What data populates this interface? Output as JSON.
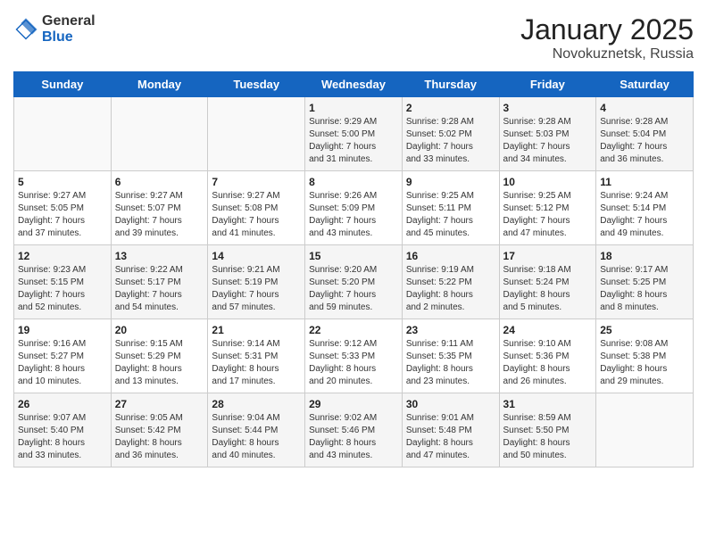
{
  "logo": {
    "general": "General",
    "blue": "Blue"
  },
  "title": {
    "month": "January 2025",
    "location": "Novokuznetsk, Russia"
  },
  "weekdays": [
    "Sunday",
    "Monday",
    "Tuesday",
    "Wednesday",
    "Thursday",
    "Friday",
    "Saturday"
  ],
  "weeks": [
    [
      {
        "day": "",
        "info": ""
      },
      {
        "day": "",
        "info": ""
      },
      {
        "day": "",
        "info": ""
      },
      {
        "day": "1",
        "info": "Sunrise: 9:29 AM\nSunset: 5:00 PM\nDaylight: 7 hours\nand 31 minutes."
      },
      {
        "day": "2",
        "info": "Sunrise: 9:28 AM\nSunset: 5:02 PM\nDaylight: 7 hours\nand 33 minutes."
      },
      {
        "day": "3",
        "info": "Sunrise: 9:28 AM\nSunset: 5:03 PM\nDaylight: 7 hours\nand 34 minutes."
      },
      {
        "day": "4",
        "info": "Sunrise: 9:28 AM\nSunset: 5:04 PM\nDaylight: 7 hours\nand 36 minutes."
      }
    ],
    [
      {
        "day": "5",
        "info": "Sunrise: 9:27 AM\nSunset: 5:05 PM\nDaylight: 7 hours\nand 37 minutes."
      },
      {
        "day": "6",
        "info": "Sunrise: 9:27 AM\nSunset: 5:07 PM\nDaylight: 7 hours\nand 39 minutes."
      },
      {
        "day": "7",
        "info": "Sunrise: 9:27 AM\nSunset: 5:08 PM\nDaylight: 7 hours\nand 41 minutes."
      },
      {
        "day": "8",
        "info": "Sunrise: 9:26 AM\nSunset: 5:09 PM\nDaylight: 7 hours\nand 43 minutes."
      },
      {
        "day": "9",
        "info": "Sunrise: 9:25 AM\nSunset: 5:11 PM\nDaylight: 7 hours\nand 45 minutes."
      },
      {
        "day": "10",
        "info": "Sunrise: 9:25 AM\nSunset: 5:12 PM\nDaylight: 7 hours\nand 47 minutes."
      },
      {
        "day": "11",
        "info": "Sunrise: 9:24 AM\nSunset: 5:14 PM\nDaylight: 7 hours\nand 49 minutes."
      }
    ],
    [
      {
        "day": "12",
        "info": "Sunrise: 9:23 AM\nSunset: 5:15 PM\nDaylight: 7 hours\nand 52 minutes."
      },
      {
        "day": "13",
        "info": "Sunrise: 9:22 AM\nSunset: 5:17 PM\nDaylight: 7 hours\nand 54 minutes."
      },
      {
        "day": "14",
        "info": "Sunrise: 9:21 AM\nSunset: 5:19 PM\nDaylight: 7 hours\nand 57 minutes."
      },
      {
        "day": "15",
        "info": "Sunrise: 9:20 AM\nSunset: 5:20 PM\nDaylight: 7 hours\nand 59 minutes."
      },
      {
        "day": "16",
        "info": "Sunrise: 9:19 AM\nSunset: 5:22 PM\nDaylight: 8 hours\nand 2 minutes."
      },
      {
        "day": "17",
        "info": "Sunrise: 9:18 AM\nSunset: 5:24 PM\nDaylight: 8 hours\nand 5 minutes."
      },
      {
        "day": "18",
        "info": "Sunrise: 9:17 AM\nSunset: 5:25 PM\nDaylight: 8 hours\nand 8 minutes."
      }
    ],
    [
      {
        "day": "19",
        "info": "Sunrise: 9:16 AM\nSunset: 5:27 PM\nDaylight: 8 hours\nand 10 minutes."
      },
      {
        "day": "20",
        "info": "Sunrise: 9:15 AM\nSunset: 5:29 PM\nDaylight: 8 hours\nand 13 minutes."
      },
      {
        "day": "21",
        "info": "Sunrise: 9:14 AM\nSunset: 5:31 PM\nDaylight: 8 hours\nand 17 minutes."
      },
      {
        "day": "22",
        "info": "Sunrise: 9:12 AM\nSunset: 5:33 PM\nDaylight: 8 hours\nand 20 minutes."
      },
      {
        "day": "23",
        "info": "Sunrise: 9:11 AM\nSunset: 5:35 PM\nDaylight: 8 hours\nand 23 minutes."
      },
      {
        "day": "24",
        "info": "Sunrise: 9:10 AM\nSunset: 5:36 PM\nDaylight: 8 hours\nand 26 minutes."
      },
      {
        "day": "25",
        "info": "Sunrise: 9:08 AM\nSunset: 5:38 PM\nDaylight: 8 hours\nand 29 minutes."
      }
    ],
    [
      {
        "day": "26",
        "info": "Sunrise: 9:07 AM\nSunset: 5:40 PM\nDaylight: 8 hours\nand 33 minutes."
      },
      {
        "day": "27",
        "info": "Sunrise: 9:05 AM\nSunset: 5:42 PM\nDaylight: 8 hours\nand 36 minutes."
      },
      {
        "day": "28",
        "info": "Sunrise: 9:04 AM\nSunset: 5:44 PM\nDaylight: 8 hours\nand 40 minutes."
      },
      {
        "day": "29",
        "info": "Sunrise: 9:02 AM\nSunset: 5:46 PM\nDaylight: 8 hours\nand 43 minutes."
      },
      {
        "day": "30",
        "info": "Sunrise: 9:01 AM\nSunset: 5:48 PM\nDaylight: 8 hours\nand 47 minutes."
      },
      {
        "day": "31",
        "info": "Sunrise: 8:59 AM\nSunset: 5:50 PM\nDaylight: 8 hours\nand 50 minutes."
      },
      {
        "day": "",
        "info": ""
      }
    ]
  ]
}
